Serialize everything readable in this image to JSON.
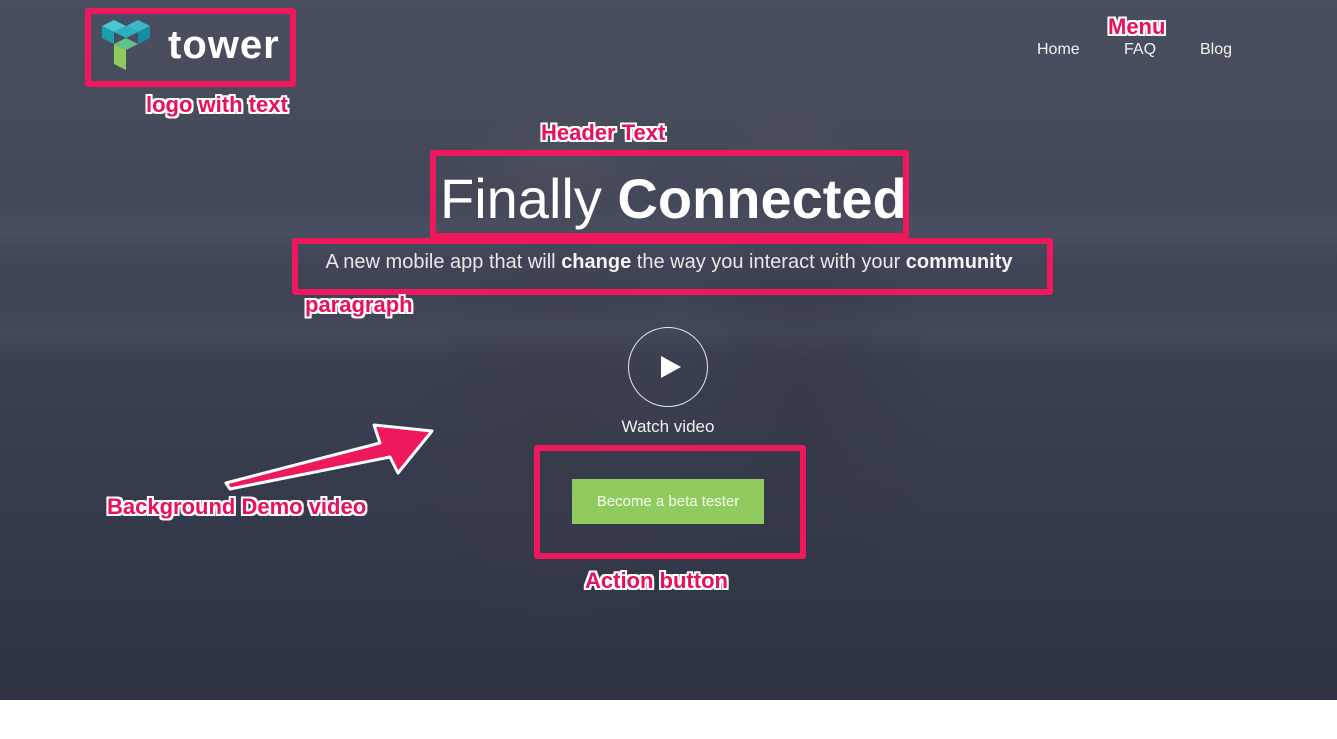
{
  "logo": {
    "text": "tower",
    "icon": "tower-logo-icon"
  },
  "nav": {
    "items": [
      "Home",
      "FAQ",
      "Blog"
    ]
  },
  "hero": {
    "headline_light": "Finally",
    "headline_bold": "Connected",
    "sub_1": "A new mobile app that will ",
    "sub_bold_1": "change",
    "sub_2": " the way you interact with your ",
    "sub_bold_2": "community",
    "watch_label": "Watch video",
    "play_icon": "play-icon",
    "cta_label": "Become a beta tester"
  },
  "annotations": {
    "logo": "logo with text",
    "menu": "Menu",
    "header": "Header Text",
    "paragraph": "paragraph",
    "background": "Background Demo video",
    "action": "Action button"
  },
  "colors": {
    "accent_annotation": "#f0185c",
    "cta_green": "#8fcb5f",
    "logo_teal": "#1fa8b8",
    "logo_green": "#8fcb5f"
  }
}
